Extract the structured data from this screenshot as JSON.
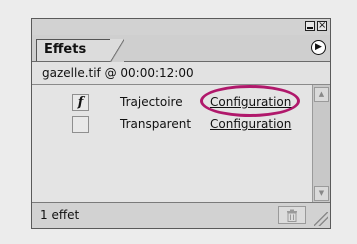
{
  "palette": {
    "tab_label": "Effets",
    "menu_icon": "triangle-right-icon",
    "minimize_icon": "minimize-icon",
    "close_icon": "close-icon",
    "close_glyph": "×",
    "menu_glyph": "▶"
  },
  "clip": {
    "label": "gazelle.tif @ 00:00:12:00"
  },
  "effects": [
    {
      "enabled_glyph": "f",
      "name": "Trajectoire",
      "config_label": "Configuration",
      "highlighted": true
    },
    {
      "enabled_glyph": "",
      "name": "Transparent",
      "config_label": "Configuration",
      "highlighted": false
    }
  ],
  "footer": {
    "count_label": "1 effet",
    "trash_icon": "trash-icon"
  },
  "colors": {
    "highlight": "#b0186b"
  }
}
